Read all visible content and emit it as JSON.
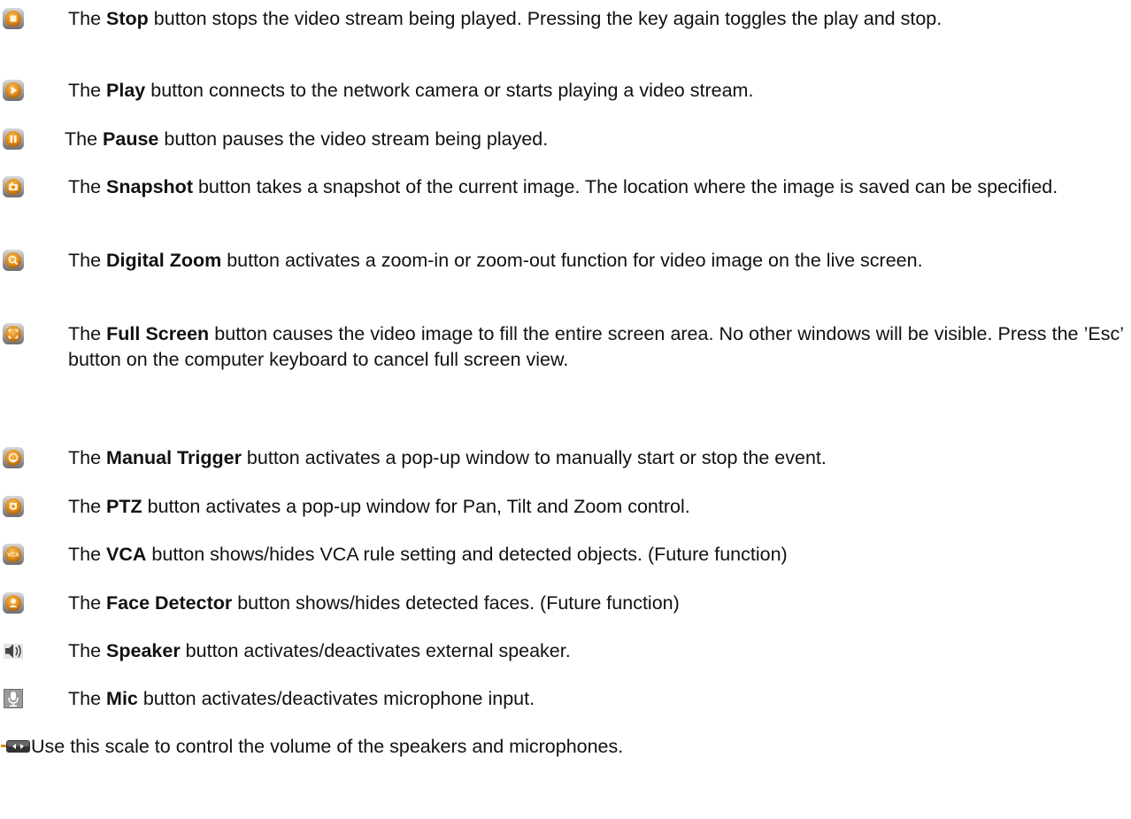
{
  "items": [
    {
      "icon": "stop-icon",
      "pre": "The ",
      "name": "Stop",
      "post": " button stops the video stream being played. Pressing the key again toggles the play and stop."
    },
    {
      "icon": "play-icon",
      "pre": "The ",
      "name": "Play",
      "post": " button connects to the network camera or starts playing a video stream."
    },
    {
      "icon": "pause-icon",
      "pre": "The ",
      "name": "Pause",
      "post": " button pauses the video stream being played."
    },
    {
      "icon": "snapshot-icon",
      "pre": "The ",
      "name": "Snapshot",
      "post": " button takes a snapshot of the current image. The location where the image is saved can be specified."
    },
    {
      "icon": "digital-zoom-icon",
      "pre": "The ",
      "name": "Digital Zoom",
      "post": " button activates a zoom-in or zoom-out function for video image on the live screen."
    },
    {
      "icon": "full-screen-icon",
      "pre": "The ",
      "name": "Full Screen",
      "post": " button causes the video image to fill the entire screen area. No other windows will be visible. Press the ’Esc’ button on the computer keyboard to cancel full screen view."
    },
    {
      "icon": "manual-trigger-icon",
      "pre": "The ",
      "name": "Manual Trigger",
      "post": " button activates a pop-up window to manually start or stop the event."
    },
    {
      "icon": "ptz-icon",
      "pre": "The ",
      "name": "PTZ",
      "post": " button activates a pop-up window for Pan, Tilt and Zoom control."
    },
    {
      "icon": "vca-icon",
      "icon_text": "VCA",
      "pre": "The ",
      "name": "VCA",
      "post": " button shows/hides VCA rule setting and detected objects. (Future function)"
    },
    {
      "icon": "face-detector-icon",
      "pre": "The ",
      "name": "Face Detector",
      "post": " button shows/hides detected faces. (Future function)"
    },
    {
      "icon": "speaker-icon",
      "pre": "The ",
      "name": "Speaker",
      "post": " button activates/deactivates external speaker."
    },
    {
      "icon": "mic-icon",
      "pre": "The ",
      "name": "Mic",
      "post": " button activates/deactivates microphone input."
    },
    {
      "icon": "volume-scale-icon",
      "text": "Use this scale to control the volume of the speakers and microphones."
    }
  ],
  "colors": {
    "orange_button": "#e08a18",
    "orange_light": "#f6b44a",
    "bevel_gray": "#8a8a8a",
    "speaker_gray": "#555555",
    "text": "#111111"
  }
}
